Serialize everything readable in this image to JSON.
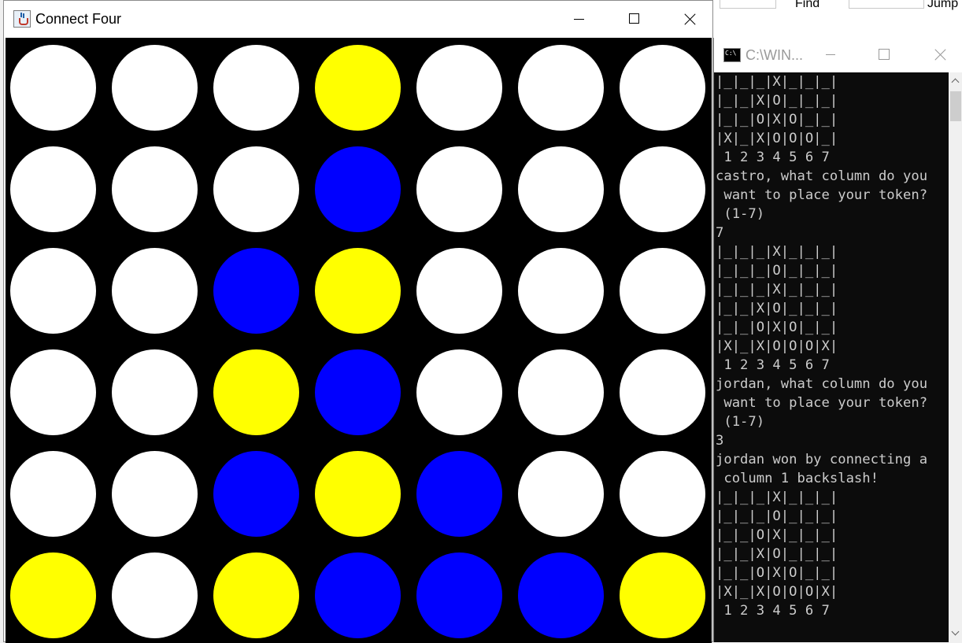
{
  "background_app": {
    "find_label": "Find",
    "jump_label": "Jump"
  },
  "game_window": {
    "title": "Connect Four",
    "colors": {
      "empty": "#ffffff",
      "yellow": "#ffff00",
      "blue": "#0000ff",
      "board": "#000000"
    },
    "board": [
      [
        "empty",
        "empty",
        "empty",
        "yellow",
        "empty",
        "empty",
        "empty"
      ],
      [
        "empty",
        "empty",
        "empty",
        "blue",
        "empty",
        "empty",
        "empty"
      ],
      [
        "empty",
        "empty",
        "blue",
        "yellow",
        "empty",
        "empty",
        "empty"
      ],
      [
        "empty",
        "empty",
        "yellow",
        "blue",
        "empty",
        "empty",
        "empty"
      ],
      [
        "empty",
        "empty",
        "blue",
        "yellow",
        "blue",
        "empty",
        "empty"
      ],
      [
        "yellow",
        "empty",
        "yellow",
        "blue",
        "blue",
        "blue",
        "yellow"
      ]
    ]
  },
  "console_window": {
    "title": "C:\\WIN...",
    "lines": [
      "|_|_|_|X|_|_|_|",
      "|_|_|X|O|_|_|_|",
      "|_|_|O|X|O|_|_|",
      "|X|_|X|O|O|O|_|",
      " 1 2 3 4 5 6 7",
      "castro, what column do you",
      " want to place your token?",
      " (1-7)",
      "7",
      "|_|_|_|X|_|_|_|",
      "|_|_|_|O|_|_|_|",
      "|_|_|_|X|_|_|_|",
      "|_|_|X|O|_|_|_|",
      "|_|_|O|X|O|_|_|",
      "|X|_|X|O|O|O|X|",
      " 1 2 3 4 5 6 7",
      "jordan, what column do you",
      " want to place your token?",
      " (1-7)",
      "3",
      "jordan won by connecting a",
      " column 1 backslash!",
      "|_|_|_|X|_|_|_|",
      "|_|_|_|O|_|_|_|",
      "|_|_|O|X|_|_|_|",
      "|_|_|X|O|_|_|_|",
      "|_|_|O|X|O|_|_|",
      "|X|_|X|O|O|O|X|",
      " 1 2 3 4 5 6 7"
    ]
  }
}
